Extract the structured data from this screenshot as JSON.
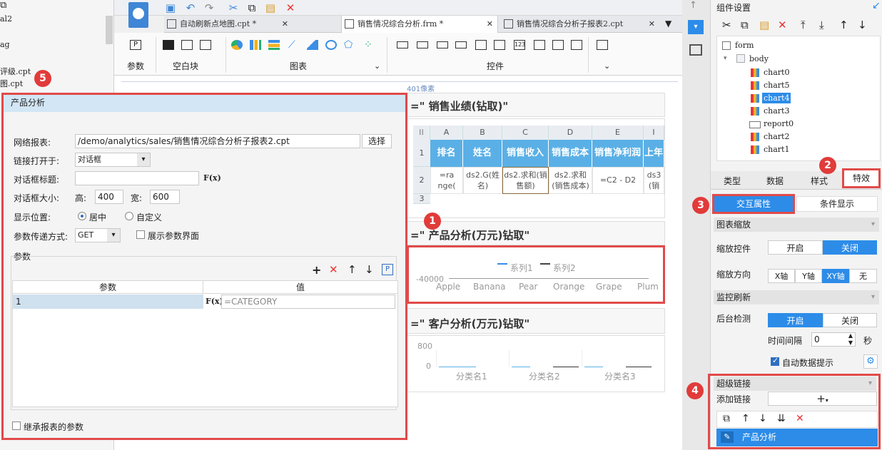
{
  "left_panel": {
    "rows": [
      "al2",
      "ag",
      "评级.cpt",
      "图.cpt"
    ]
  },
  "tabs": [
    {
      "label": "自动刷新点地图.cpt *"
    },
    {
      "label": "销售情况综合分析.frm *"
    },
    {
      "label": "销售情况综合分析子报表2.cpt"
    }
  ],
  "ribbon": {
    "groups": [
      "参数",
      "空白块",
      "图表",
      "控件"
    ]
  },
  "canvas": {
    "ruler": "401像素",
    "sections": [
      "=\" 销售业绩(钻取)\"",
      "=\" 产品分析(万元)钻取\"",
      "=\" 客户分析(万元)钻取\""
    ],
    "grid": {
      "cols": [
        "A",
        "B",
        "C",
        "D",
        "E",
        "I"
      ],
      "rows": [
        "1",
        "2",
        "3"
      ],
      "headers": [
        "排名",
        "姓名",
        "销售收入",
        "销售成本",
        "销售净利润",
        "上年"
      ],
      "cells": [
        "=ra nge(",
        "ds2.G(姓名)",
        "ds2.求和(销售额)",
        "ds2.求和(销售成本)",
        "=C2 - D2",
        "ds3 (销"
      ]
    },
    "chart1": {
      "legend": [
        "系列1",
        "系列2"
      ],
      "ytick": "-40000",
      "xcats": [
        "Apple",
        "Banana",
        "Pear",
        "Orange",
        "Grape",
        "Plum"
      ]
    },
    "chart2": {
      "yticks": [
        "800",
        "0"
      ],
      "xcats": [
        "分类名1",
        "分类名2",
        "分类名3"
      ]
    }
  },
  "chart_data": [
    {
      "type": "line",
      "categories": [
        "Apple",
        "Banana",
        "Pear",
        "Orange",
        "Grape",
        "Plum"
      ],
      "series": [
        {
          "name": "系列1",
          "values": []
        },
        {
          "name": "系列2",
          "values": []
        }
      ],
      "yticks": [
        "-40000"
      ]
    },
    {
      "type": "bar",
      "categories": [
        "分类名1",
        "分类名2",
        "分类名3"
      ],
      "yticks": [
        "800",
        "0"
      ],
      "ylim": [
        0,
        800
      ]
    }
  ],
  "dialog": {
    "title": "产品分析",
    "net_report_label": "网络报表:",
    "net_report_value": "/demo/analytics/sales/销售情况综合分析子报表2.cpt",
    "choose_btn": "选择",
    "open_in_label": "链接打开于:",
    "open_in_value": "对话框",
    "dialog_title_label": "对话框标题:",
    "dialog_title_value": "",
    "size_label": "对话框大小:",
    "height_label": "高:",
    "height_value": "400",
    "width_label": "宽:",
    "width_value": "600",
    "pos_label": "显示位置:",
    "pos_center": "居中",
    "pos_custom": "自定义",
    "method_label": "参数传递方式:",
    "method_value": "GET",
    "show_params": "展示参数界面",
    "params_label": "参数",
    "col_param": "参数",
    "col_value": "值",
    "row_param": "1",
    "row_value": "=CATEGORY",
    "inherit": "继承报表的参数",
    "fx": "F(x)"
  },
  "right": {
    "title": "组件设置",
    "tree": [
      "form",
      "body",
      "chart0",
      "chart5",
      "chart4",
      "chart3",
      "report0",
      "chart2",
      "chart1"
    ],
    "tabs": [
      "类型",
      "数据",
      "样式",
      "特效"
    ],
    "subtabs": [
      "交互属性",
      "条件显示"
    ],
    "zoom_section": "图表缩放",
    "zoom_ctl_label": "缩放控件",
    "on": "开启",
    "off": "关闭",
    "zoom_dir_label": "缩放方向",
    "dirs": [
      "X轴",
      "Y轴",
      "XY轴",
      "无"
    ],
    "monitor_section": "监控刷新",
    "bg_label": "后台检测",
    "interval_label": "时间间隔",
    "interval_value": "0",
    "sec": "秒",
    "auto_tip": "自动数据提示",
    "link_section": "超级链接",
    "add_link_label": "添加链接",
    "link_item": "产品分析"
  },
  "markers": [
    "1",
    "2",
    "3",
    "4",
    "5"
  ],
  "colors": {
    "accent": "#2d8ce8",
    "highlight": "#e14a4a",
    "header": "#5ab0e6"
  }
}
